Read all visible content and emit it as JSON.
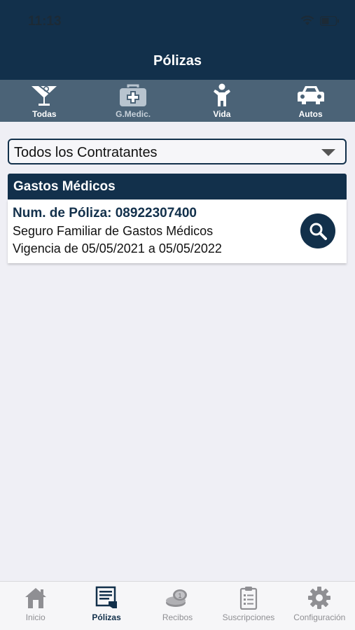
{
  "status": {
    "time": "11:13"
  },
  "header": {
    "title": "Pólizas"
  },
  "categories": [
    {
      "label": "Todas",
      "icon": "cocktail-glass-icon"
    },
    {
      "label": "G.Medic.",
      "icon": "medical-kit-icon"
    },
    {
      "label": "Vida",
      "icon": "person-icon"
    },
    {
      "label": "Autos",
      "icon": "car-icon"
    }
  ],
  "filter": {
    "selected": "Todos los Contratantes"
  },
  "section": {
    "title": "Gastos Médicos"
  },
  "policy": {
    "number": "Num. de Póliza: 08922307400",
    "name": "Seguro Familiar de Gastos Médicos",
    "validity": "Vigencia de 05/05/2021 a 05/05/2022"
  },
  "tabs": [
    {
      "label": "Inicio",
      "icon": "home-icon"
    },
    {
      "label": "Pólizas",
      "icon": "policy-document-icon",
      "active": true
    },
    {
      "label": "Recibos",
      "icon": "coins-icon"
    },
    {
      "label": "Suscripciones",
      "icon": "clipboard-icon"
    },
    {
      "label": "Configuración",
      "icon": "gear-icon"
    }
  ],
  "colors": {
    "primary": "#12304b",
    "category_bar": "#4b6377",
    "background": "#efeff5"
  }
}
